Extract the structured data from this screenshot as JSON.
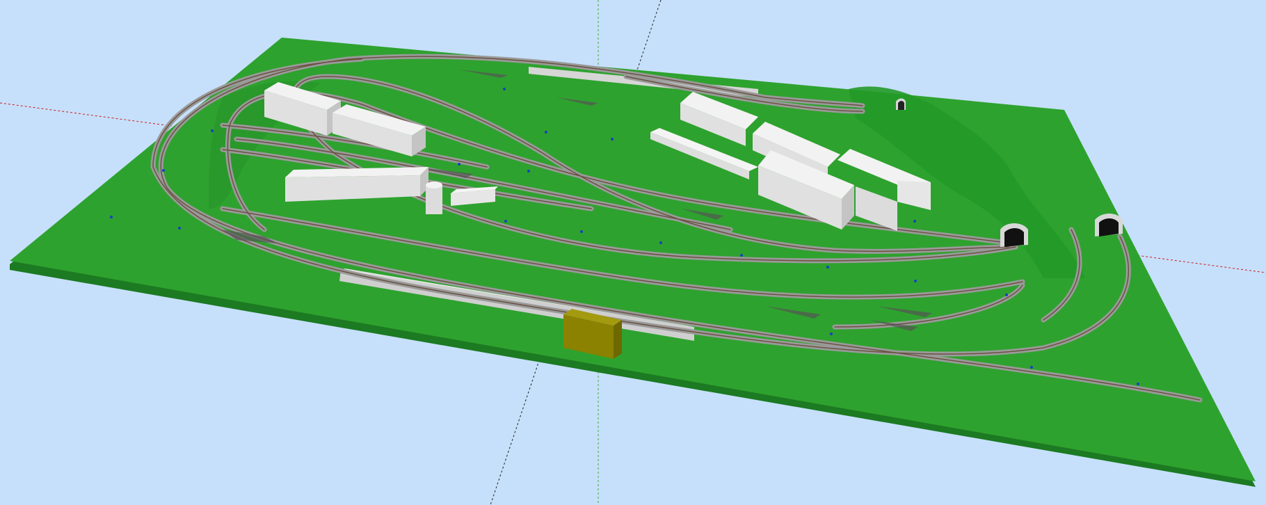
{
  "app": {
    "view_type": "3d-layout-perspective"
  },
  "colors": {
    "sky": "#c6e0fb",
    "board": "#2ea22e",
    "board_edge": "#1c7a22",
    "ballast": "#9a9a9a",
    "rail": "#6b5242",
    "tie": "#b58a74",
    "building": "#e6e6e6",
    "building_shade": "#c8c8c8",
    "station_building": "#8a8200",
    "axis_x": "#d01818",
    "axis_y": "#222222",
    "axis_z": "#30b030",
    "signal": "#1840c0"
  },
  "objects": {
    "baseboard": "green-baseboard",
    "tracks": "track-network",
    "platforms": [
      "lower-platform",
      "upper-platform"
    ],
    "buildings": [
      "warehouse-left-1",
      "warehouse-left-2",
      "warehouse-left-3",
      "silo",
      "small-shed",
      "industry-right-1",
      "industry-right-2",
      "industry-right-3",
      "industry-right-4",
      "industry-right-5"
    ],
    "station_building": "station-building",
    "tunnels": [
      "tunnel-portal-center",
      "tunnel-portal-right",
      "tunnel-portal-small"
    ]
  }
}
